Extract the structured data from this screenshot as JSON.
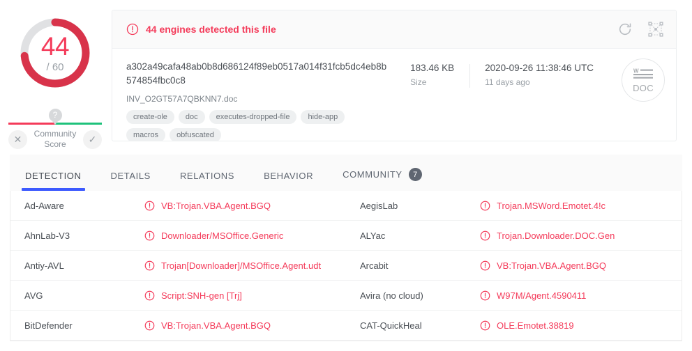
{
  "score": {
    "detections": "44",
    "total": "/ 60",
    "arc_color": "#d8334a",
    "track_color": "#e0e1e3",
    "value_color": "#f43b5a",
    "detected": 44,
    "engines_total": 60
  },
  "community_score": {
    "label": "Community\nScore",
    "label_line1": "Community",
    "label_line2": "Score",
    "marker": "?",
    "negative_icon": "close-icon",
    "positive_icon": "check-icon",
    "negative_glyph": "✕",
    "positive_glyph": "✓",
    "negative_color": "#f43b5a",
    "positive_color": "#1ec27b"
  },
  "file_card": {
    "alert_text": "44 engines detected this file",
    "alert_icon": "alert-circle-icon",
    "alert_color": "#f43b5a",
    "hash": "a302a49cafa48ab0b8d686124f89eb0517a014f31fcb5dc4eb8b574854fbc0c8",
    "filename": "INV_O2GT57A7QBKNN7.doc",
    "tags": [
      "create-ole",
      "doc",
      "executes-dropped-file",
      "hide-app",
      "macros",
      "obfuscated"
    ],
    "stats": [
      {
        "value": "183.46 KB",
        "label": "Size"
      },
      {
        "value": "2020-09-26 11:38:46 UTC",
        "label": "11 days ago"
      }
    ],
    "filetype": {
      "badge_letter": "W",
      "ext": "DOC"
    },
    "actions": [
      {
        "name": "reanalyze-icon",
        "title": "reanalyze"
      },
      {
        "name": "similar-graph-icon",
        "title": "similar"
      }
    ]
  },
  "tabs": [
    {
      "label": "DETECTION",
      "active": true,
      "badge": null
    },
    {
      "label": "DETAILS",
      "active": false,
      "badge": null
    },
    {
      "label": "RELATIONS",
      "active": false,
      "badge": null
    },
    {
      "label": "BEHAVIOR",
      "active": false,
      "badge": null
    },
    {
      "label": "COMMUNITY",
      "active": false,
      "badge": "7"
    }
  ],
  "detections": [
    {
      "engine": "Ad-Aware",
      "verdict": "VB:Trojan.VBA.Agent.BGQ"
    },
    {
      "engine": "AegisLab",
      "verdict": "Trojan.MSWord.Emotet.4!c"
    },
    {
      "engine": "AhnLab-V3",
      "verdict": "Downloader/MSOffice.Generic"
    },
    {
      "engine": "ALYac",
      "verdict": "Trojan.Downloader.DOC.Gen"
    },
    {
      "engine": "Antiy-AVL",
      "verdict": "Trojan[Downloader]/MSOffice.Agent.udt"
    },
    {
      "engine": "Arcabit",
      "verdict": "VB:Trojan.VBA.Agent.BGQ"
    },
    {
      "engine": "AVG",
      "verdict": "Script:SNH-gen [Trj]"
    },
    {
      "engine": "Avira (no cloud)",
      "verdict": "W97M/Agent.4590411"
    },
    {
      "engine": "BitDefender",
      "verdict": "VB:Trojan.VBA.Agent.BGQ"
    },
    {
      "engine": "CAT-QuickHeal",
      "verdict": "OLE.Emotet.38819"
    }
  ]
}
